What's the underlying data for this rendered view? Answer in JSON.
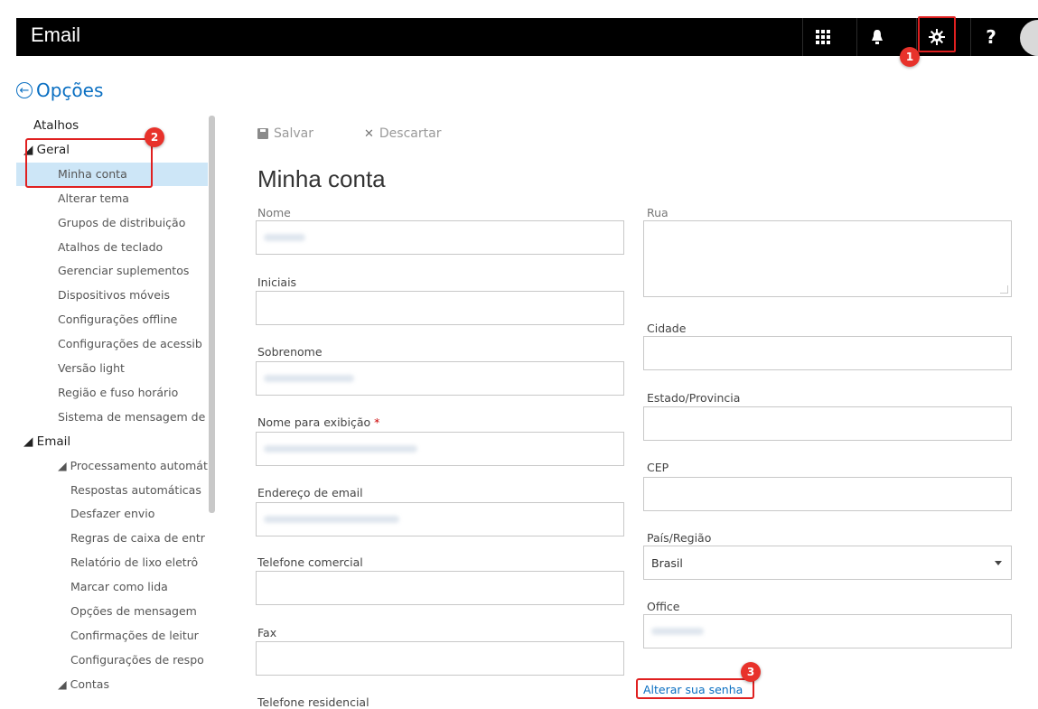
{
  "app": {
    "title": "Email",
    "top_icons": [
      "app-launcher-icon",
      "bell-icon",
      "gear-icon",
      "help-icon"
    ],
    "help_glyph": "?"
  },
  "options": {
    "title": "Opções"
  },
  "steps": {
    "one": "1",
    "two": "2",
    "three": "3"
  },
  "sidebar": {
    "items": [
      {
        "label": "Atalhos",
        "type": "header"
      },
      {
        "label": "◢ Geral",
        "type": "header"
      },
      {
        "label": "Minha conta",
        "type": "item",
        "selected": true
      },
      {
        "label": "Alterar tema",
        "type": "item"
      },
      {
        "label": "Grupos de distribuição",
        "type": "item"
      },
      {
        "label": "Atalhos de teclado",
        "type": "item"
      },
      {
        "label": "Gerenciar suplementos",
        "type": "item"
      },
      {
        "label": "Dispositivos móveis",
        "type": "item"
      },
      {
        "label": "Configurações offline",
        "type": "item"
      },
      {
        "label": "Configurações de acessib",
        "type": "item"
      },
      {
        "label": "Versão light",
        "type": "item"
      },
      {
        "label": "Região e fuso horário",
        "type": "item"
      },
      {
        "label": "Sistema de mensagem de",
        "type": "item"
      },
      {
        "label": "◢ Email",
        "type": "header"
      },
      {
        "label": "◢ Processamento automáti",
        "type": "sub"
      },
      {
        "label": "Respostas automáticas",
        "type": "subitem"
      },
      {
        "label": "Desfazer envio",
        "type": "subitem"
      },
      {
        "label": "Regras de caixa de entr",
        "type": "subitem"
      },
      {
        "label": "Relatório de lixo eletrô",
        "type": "subitem"
      },
      {
        "label": "Marcar como lida",
        "type": "subitem"
      },
      {
        "label": "Opções de mensagem",
        "type": "subitem"
      },
      {
        "label": "Confirmações de leitur",
        "type": "subitem"
      },
      {
        "label": "Configurações de respo",
        "type": "subitem"
      },
      {
        "label": "◢ Contas",
        "type": "sub"
      }
    ]
  },
  "toolbar": {
    "save_label": "Salvar",
    "discard_label": "Descartar",
    "discard_glyph": "✕"
  },
  "page": {
    "title": "Minha conta"
  },
  "form": {
    "left": {
      "nome": "Nome",
      "iniciais": "Iniciais",
      "sobrenome": "Sobrenome",
      "nome_exibicao": "Nome para exibição",
      "required_mark": "*",
      "email": "Endereço de email",
      "telefone_comercial": "Telefone comercial",
      "fax": "Fax",
      "telefone_residencial": "Telefone residencial"
    },
    "right": {
      "rua": "Rua",
      "cidade": "Cidade",
      "estado": "Estado/Provincia",
      "cep": "CEP",
      "pais": "País/Região",
      "pais_value": "Brasil",
      "office": "Office"
    },
    "change_password_link": "Alterar sua senha"
  }
}
